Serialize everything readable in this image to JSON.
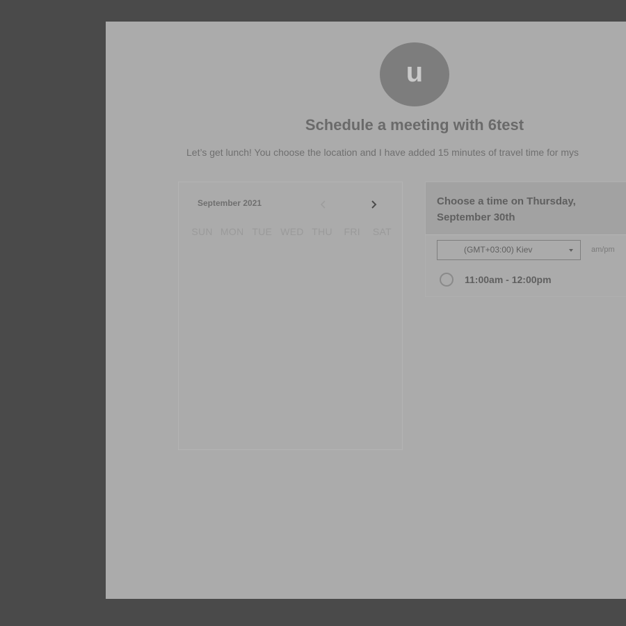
{
  "profile": {
    "avatar_letter": "u",
    "title": "Schedule a meeting with 6test",
    "description": "Let’s get lunch! You choose the location and I have added 15 minutes of travel time for mys"
  },
  "calendar": {
    "month_label": "September 2021",
    "prev_icon": "chevron-left-icon",
    "next_icon": "chevron-right-icon",
    "weekdays": [
      "SUN",
      "MON",
      "TUE",
      "WED",
      "THU",
      "FRI",
      "SAT"
    ]
  },
  "time_panel": {
    "header": "Choose a time on Thursday, September 30th",
    "timezone_selected": "(GMT+03:00) Kiev",
    "format_label": "am/pm",
    "slots": [
      {
        "label": "11:00am - 12:00pm"
      }
    ]
  },
  "colors": {
    "backdrop": "#4a4a4a",
    "page": "#ababab",
    "avatar": "#7d7d7d"
  }
}
